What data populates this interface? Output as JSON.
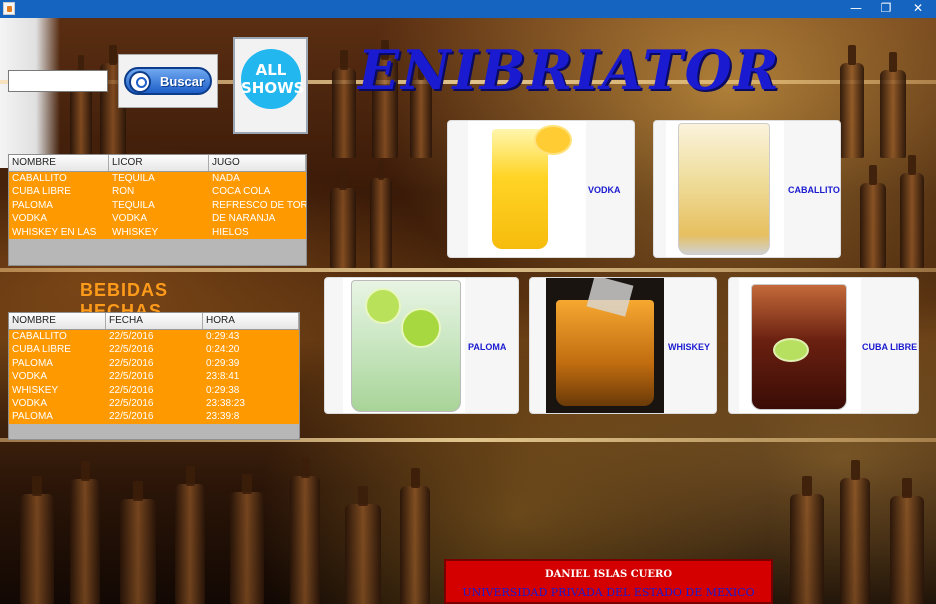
{
  "window": {
    "minimize_glyph": "—",
    "restore_glyph": "❐",
    "close_glyph": "✕"
  },
  "search": {
    "value": "",
    "button_label": "Buscar",
    "all_shows_line1": "ALL",
    "all_shows_line2": "SHOWS"
  },
  "title": "ENIBRIATOR",
  "recipes": {
    "headers": [
      "NOMBRE",
      "LICOR",
      "JUGO"
    ],
    "rows": [
      [
        "CABALLITO",
        "TEQUILA",
        "NADA"
      ],
      [
        "CUBA LIBRE",
        "RON",
        "COCA COLA"
      ],
      [
        "PALOMA",
        "TEQUILA",
        "REFRESCO DE TOR"
      ],
      [
        "VODKA",
        "VODKA",
        "DE NARANJA"
      ],
      [
        "WHISKEY EN LAS",
        "WHISKEY",
        "HIELOS"
      ]
    ]
  },
  "made_label": "BEBIDAS HECHAS",
  "made": {
    "headers": [
      "NOMBRE",
      "FECHA",
      "HORA"
    ],
    "rows": [
      [
        "CABALLITO",
        "22/5/2016",
        "0:29:43"
      ],
      [
        "CUBA LIBRE",
        "22/5/2016",
        "0:24:20"
      ],
      [
        "PALOMA",
        "22/5/2016",
        "0:29:39"
      ],
      [
        "VODKA",
        "22/5/2016",
        "23:8:41"
      ],
      [
        "WHISKEY",
        "22/5/2016",
        "0:29:38"
      ],
      [
        "VODKA",
        "22/5/2016",
        "23:38:23"
      ],
      [
        "PALOMA",
        "22/5/2016",
        "23:39:8"
      ]
    ]
  },
  "drinks": {
    "vodka": "VODKA",
    "caballito": "CABALLITO",
    "paloma": "PALOMA",
    "whiskey": "WHISKEY",
    "cuba_libre": "CUBA LIBRE"
  },
  "footer": {
    "name": "DANIEL ISLAS CUERO",
    "university": "UNIVERSIDAD PRIVADA DEL ESTADO DE MEXICO"
  },
  "colors": {
    "titlebar": "#1565c0",
    "table_body": "#ff9900",
    "title_text": "#1a1ad0",
    "footer_bg": "#d40000"
  }
}
